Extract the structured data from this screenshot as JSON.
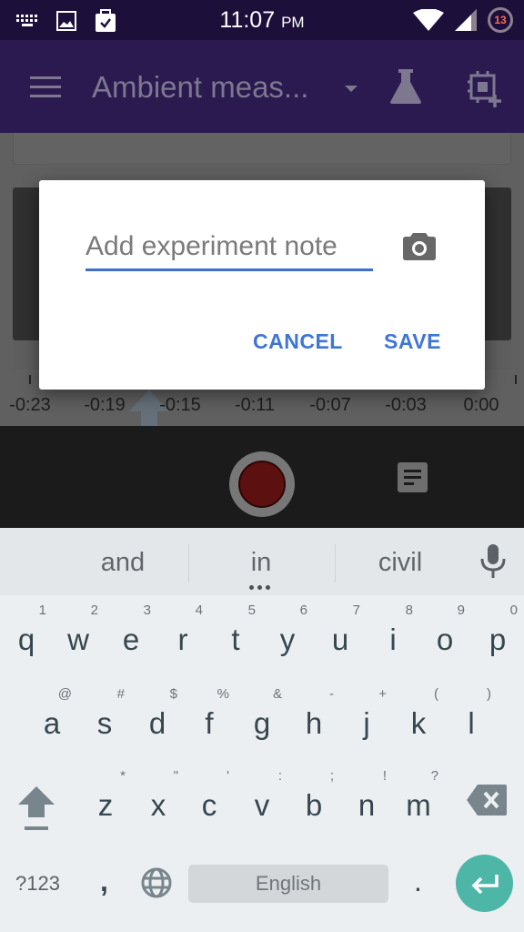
{
  "status_bar": {
    "time": "11:07",
    "ampm": "PM",
    "notification_count": "13",
    "left_icons": [
      "keyboard-icon",
      "image-icon",
      "clipboard-check-icon"
    ],
    "right_icons": [
      "wifi-icon",
      "cell-signal-icon"
    ]
  },
  "app_bar": {
    "title": "Ambient meas...",
    "icons": [
      "menu-icon",
      "dropdown-caret-icon",
      "flask-icon",
      "device-add-icon"
    ]
  },
  "timeline": {
    "labels": [
      "-0:23",
      "-0:19",
      "-0:15",
      "-0:11",
      "-0:07",
      "-0:03",
      "0:00"
    ]
  },
  "controls": {
    "record_color": "#5d1010"
  },
  "dialog": {
    "input_placeholder": "Add experiment note",
    "input_value": "",
    "cancel_label": "CANCEL",
    "save_label": "SAVE",
    "accent_color": "#3f76d6"
  },
  "keyboard": {
    "suggestions": [
      "and",
      "in",
      "civil"
    ],
    "row1": [
      {
        "key": "q",
        "hint": "1"
      },
      {
        "key": "w",
        "hint": "2"
      },
      {
        "key": "e",
        "hint": "3"
      },
      {
        "key": "r",
        "hint": "4"
      },
      {
        "key": "t",
        "hint": "5"
      },
      {
        "key": "y",
        "hint": "6"
      },
      {
        "key": "u",
        "hint": "7"
      },
      {
        "key": "i",
        "hint": "8"
      },
      {
        "key": "o",
        "hint": "9"
      },
      {
        "key": "p",
        "hint": "0"
      }
    ],
    "row2": [
      {
        "key": "a",
        "hint": "@"
      },
      {
        "key": "s",
        "hint": "#"
      },
      {
        "key": "d",
        "hint": "$"
      },
      {
        "key": "f",
        "hint": "%"
      },
      {
        "key": "g",
        "hint": "&"
      },
      {
        "key": "h",
        "hint": "-"
      },
      {
        "key": "j",
        "hint": "+"
      },
      {
        "key": "k",
        "hint": "("
      },
      {
        "key": "l",
        "hint": ")"
      }
    ],
    "row3": [
      {
        "key": "z",
        "hint": "*"
      },
      {
        "key": "x",
        "hint": "\""
      },
      {
        "key": "c",
        "hint": "'"
      },
      {
        "key": "v",
        "hint": ":"
      },
      {
        "key": "b",
        "hint": ";"
      },
      {
        "key": "n",
        "hint": "!"
      },
      {
        "key": "m",
        "hint": "?"
      }
    ],
    "symbols_label": "?123",
    "comma": ",",
    "space_label": "English",
    "period": ".",
    "enter_color": "#4db6a7"
  }
}
